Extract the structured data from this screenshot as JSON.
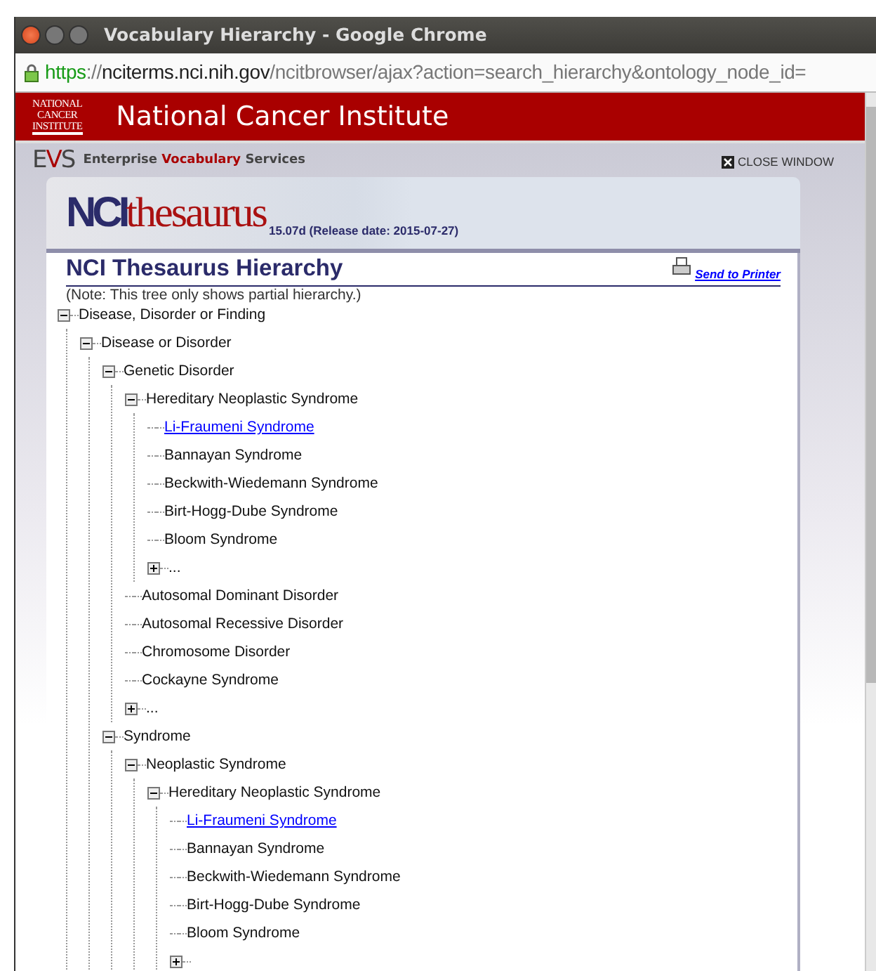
{
  "window": {
    "title": "Vocabulary Hierarchy - Google Chrome"
  },
  "address_bar": {
    "scheme": "https",
    "separator": "://",
    "host": "nciterms.nci.nih.gov",
    "path": "/ncitbrowser/ajax?action=search_hierarchy&ontology_node_id="
  },
  "banner": {
    "logo_lines": [
      "NATIONAL",
      "CANCER",
      "INSTITUTE"
    ],
    "title": "National Cancer Institute"
  },
  "evs": {
    "logo_parts": [
      "E",
      "V",
      "S"
    ],
    "tagline_parts": [
      "Enterprise",
      "Vocabulary",
      "Services"
    ],
    "close_label": "CLOSE WINDOW"
  },
  "thesaurus": {
    "logo_parts": [
      "NCI",
      "thesaurus"
    ],
    "version": "15.07d (Release date: 2015-07-27)"
  },
  "page": {
    "title": "NCI Thesaurus Hierarchy",
    "print_link": "Send to Printer",
    "note": "(Note: This tree only shows partial hierarchy.)"
  },
  "tree": [
    {
      "kind": "term",
      "label": "Disease, Disorder or Finding",
      "expanded": true,
      "children": [
        {
          "kind": "term",
          "label": "Disease or Disorder",
          "expanded": true,
          "children": [
            {
              "kind": "term",
              "label": "Genetic Disorder",
              "expanded": true,
              "children": [
                {
                  "kind": "term",
                  "label": "Hereditary Neoplastic Syndrome",
                  "expanded": true,
                  "children": [
                    {
                      "kind": "link",
                      "label": "Li-Fraumeni Syndrome"
                    },
                    {
                      "kind": "term",
                      "label": "Bannayan Syndrome"
                    },
                    {
                      "kind": "term",
                      "label": "Beckwith-Wiedemann Syndrome"
                    },
                    {
                      "kind": "term",
                      "label": "Birt-Hogg-Dube Syndrome"
                    },
                    {
                      "kind": "term",
                      "label": "Bloom Syndrome"
                    },
                    {
                      "kind": "term",
                      "label": "...",
                      "expanded": false
                    }
                  ]
                },
                {
                  "kind": "term",
                  "label": "Autosomal Dominant Disorder"
                },
                {
                  "kind": "term",
                  "label": "Autosomal Recessive Disorder"
                },
                {
                  "kind": "term",
                  "label": "Chromosome Disorder"
                },
                {
                  "kind": "term",
                  "label": "Cockayne Syndrome"
                },
                {
                  "kind": "term",
                  "label": "...",
                  "expanded": false
                }
              ]
            },
            {
              "kind": "term",
              "label": "Syndrome",
              "expanded": true,
              "children": [
                {
                  "kind": "term",
                  "label": "Neoplastic Syndrome",
                  "expanded": true,
                  "children": [
                    {
                      "kind": "term",
                      "label": "Hereditary Neoplastic Syndrome",
                      "expanded": true,
                      "children": [
                        {
                          "kind": "link",
                          "label": "Li-Fraumeni Syndrome"
                        },
                        {
                          "kind": "term",
                          "label": "Bannayan Syndrome"
                        },
                        {
                          "kind": "term",
                          "label": "Beckwith-Wiedemann Syndrome"
                        },
                        {
                          "kind": "term",
                          "label": "Birt-Hogg-Dube Syndrome"
                        },
                        {
                          "kind": "term",
                          "label": "Bloom Syndrome"
                        },
                        {
                          "expanded": false
                        }
                      ]
                    }
                  ]
                }
              ]
            }
          ]
        }
      ]
    }
  ]
}
